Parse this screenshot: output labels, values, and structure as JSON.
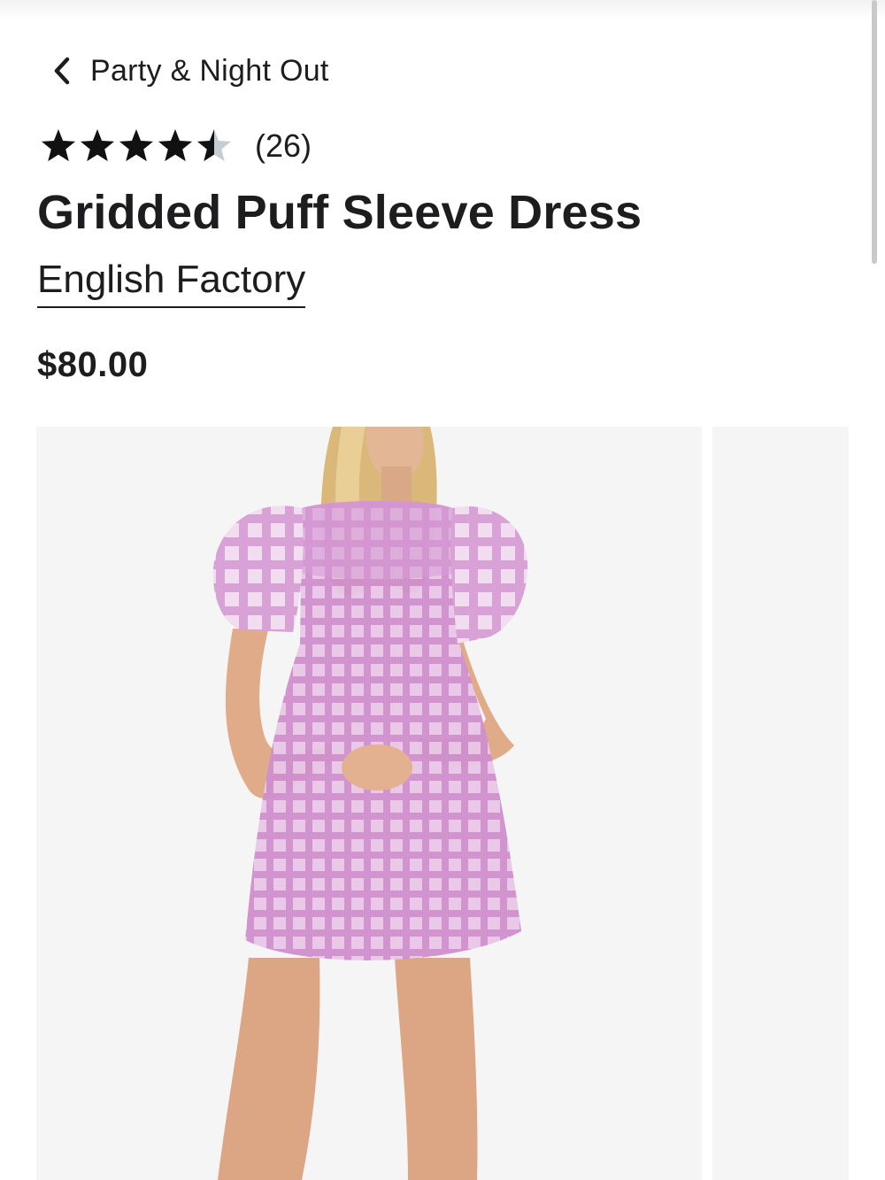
{
  "breadcrumb": {
    "label": "Party & Night Out",
    "icon": "chevron-left-icon"
  },
  "rating": {
    "stars": 4.5,
    "max_stars": 5,
    "review_count": "(26)",
    "filled_color": "#111111",
    "empty_color": "#c4cdd2"
  },
  "product": {
    "title": "Gridded Puff Sleeve Dress",
    "brand": "English Factory",
    "price": "$80.00"
  },
  "gallery": {
    "slide_count_visible": 2,
    "dress_color": "#d8a0d6",
    "background_color": "#f5f5f5"
  }
}
